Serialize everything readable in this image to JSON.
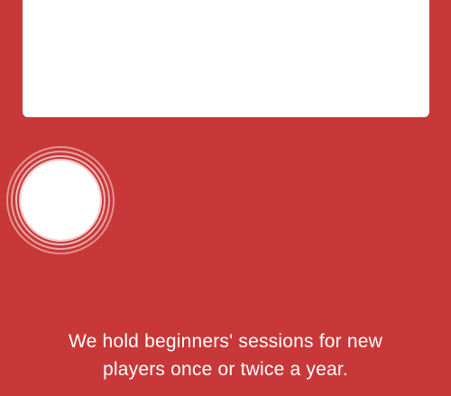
{
  "theme": {
    "background_color": "#c93838",
    "card_color": "#ffffff",
    "text_color": "#ffffff"
  },
  "ripple_button": {
    "icon": "white-circle-with-ripple-rings"
  },
  "content": {
    "description_line_1": "We hold beginners' sessions for new",
    "description_line_2": "players once or twice a year."
  }
}
